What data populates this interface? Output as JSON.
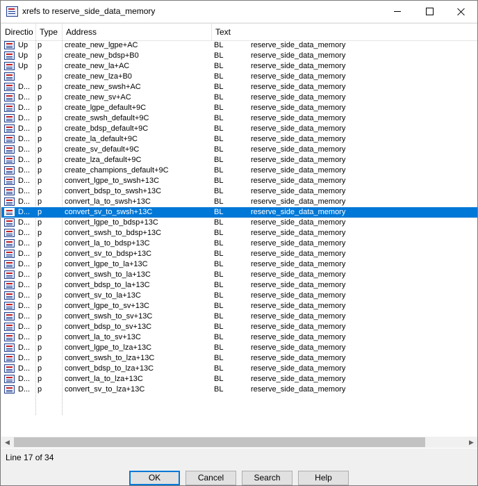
{
  "window": {
    "title": "xrefs to reserve_side_data_memory",
    "minimize_glyph": "minimize",
    "maximize_glyph": "maximize",
    "close_glyph": "close"
  },
  "columns": {
    "direction": "Directio",
    "type": "Type",
    "address": "Address",
    "text": "Text"
  },
  "rows": [
    {
      "dir": "Up",
      "type": "p",
      "address": "create_new_lgpe+AC",
      "text1": "BL",
      "text2": "reserve_side_data_memory"
    },
    {
      "dir": "Up",
      "type": "p",
      "address": "create_new_bdsp+B0",
      "text1": "BL",
      "text2": "reserve_side_data_memory"
    },
    {
      "dir": "Up",
      "type": "p",
      "address": "create_new_la+AC",
      "text1": "BL",
      "text2": "reserve_side_data_memory"
    },
    {
      "dir": "",
      "type": "p",
      "address": "create_new_lza+B0",
      "text1": "BL",
      "text2": "reserve_side_data_memory"
    },
    {
      "dir": "D...",
      "type": "p",
      "address": "create_new_swsh+AC",
      "text1": "BL",
      "text2": "reserve_side_data_memory"
    },
    {
      "dir": "D...",
      "type": "p",
      "address": "create_new_sv+AC",
      "text1": "BL",
      "text2": "reserve_side_data_memory"
    },
    {
      "dir": "D...",
      "type": "p",
      "address": "create_lgpe_default+9C",
      "text1": "BL",
      "text2": "reserve_side_data_memory"
    },
    {
      "dir": "D...",
      "type": "p",
      "address": "create_swsh_default+9C",
      "text1": "BL",
      "text2": "reserve_side_data_memory"
    },
    {
      "dir": "D...",
      "type": "p",
      "address": "create_bdsp_default+9C",
      "text1": "BL",
      "text2": "reserve_side_data_memory"
    },
    {
      "dir": "D...",
      "type": "p",
      "address": "create_la_default+9C",
      "text1": "BL",
      "text2": "reserve_side_data_memory"
    },
    {
      "dir": "D...",
      "type": "p",
      "address": "create_sv_default+9C",
      "text1": "BL",
      "text2": "reserve_side_data_memory"
    },
    {
      "dir": "D...",
      "type": "p",
      "address": "create_lza_default+9C",
      "text1": "BL",
      "text2": "reserve_side_data_memory"
    },
    {
      "dir": "D...",
      "type": "p",
      "address": "create_champions_default+9C",
      "text1": "BL",
      "text2": "reserve_side_data_memory"
    },
    {
      "dir": "D...",
      "type": "p",
      "address": "convert_lgpe_to_swsh+13C",
      "text1": "BL",
      "text2": "reserve_side_data_memory"
    },
    {
      "dir": "D...",
      "type": "p",
      "address": "convert_bdsp_to_swsh+13C",
      "text1": "BL",
      "text2": "reserve_side_data_memory"
    },
    {
      "dir": "D...",
      "type": "p",
      "address": "convert_la_to_swsh+13C",
      "text1": "BL",
      "text2": "reserve_side_data_memory"
    },
    {
      "dir": "D...",
      "type": "p",
      "address": "convert_sv_to_swsh+13C",
      "text1": "BL",
      "text2": "reserve_side_data_memory",
      "selected": true
    },
    {
      "dir": "D...",
      "type": "p",
      "address": "convert_lgpe_to_bdsp+13C",
      "text1": "BL",
      "text2": "reserve_side_data_memory"
    },
    {
      "dir": "D...",
      "type": "p",
      "address": "convert_swsh_to_bdsp+13C",
      "text1": "BL",
      "text2": "reserve_side_data_memory"
    },
    {
      "dir": "D...",
      "type": "p",
      "address": "convert_la_to_bdsp+13C",
      "text1": "BL",
      "text2": "reserve_side_data_memory"
    },
    {
      "dir": "D...",
      "type": "p",
      "address": "convert_sv_to_bdsp+13C",
      "text1": "BL",
      "text2": "reserve_side_data_memory"
    },
    {
      "dir": "D...",
      "type": "p",
      "address": "convert_lgpe_to_la+13C",
      "text1": "BL",
      "text2": "reserve_side_data_memory"
    },
    {
      "dir": "D...",
      "type": "p",
      "address": "convert_swsh_to_la+13C",
      "text1": "BL",
      "text2": "reserve_side_data_memory"
    },
    {
      "dir": "D...",
      "type": "p",
      "address": "convert_bdsp_to_la+13C",
      "text1": "BL",
      "text2": "reserve_side_data_memory"
    },
    {
      "dir": "D...",
      "type": "p",
      "address": "convert_sv_to_la+13C",
      "text1": "BL",
      "text2": "reserve_side_data_memory"
    },
    {
      "dir": "D...",
      "type": "p",
      "address": "convert_lgpe_to_sv+13C",
      "text1": "BL",
      "text2": "reserve_side_data_memory"
    },
    {
      "dir": "D...",
      "type": "p",
      "address": "convert_swsh_to_sv+13C",
      "text1": "BL",
      "text2": "reserve_side_data_memory"
    },
    {
      "dir": "D...",
      "type": "p",
      "address": "convert_bdsp_to_sv+13C",
      "text1": "BL",
      "text2": "reserve_side_data_memory"
    },
    {
      "dir": "D...",
      "type": "p",
      "address": "convert_la_to_sv+13C",
      "text1": "BL",
      "text2": "reserve_side_data_memory"
    },
    {
      "dir": "D...",
      "type": "p",
      "address": "convert_lgpe_to_lza+13C",
      "text1": "BL",
      "text2": "reserve_side_data_memory"
    },
    {
      "dir": "D...",
      "type": "p",
      "address": "convert_swsh_to_lza+13C",
      "text1": "BL",
      "text2": "reserve_side_data_memory"
    },
    {
      "dir": "D...",
      "type": "p",
      "address": "convert_bdsp_to_lza+13C",
      "text1": "BL",
      "text2": "reserve_side_data_memory"
    },
    {
      "dir": "D...",
      "type": "p",
      "address": "convert_la_to_lza+13C",
      "text1": "BL",
      "text2": "reserve_side_data_memory"
    },
    {
      "dir": "D...",
      "type": "p",
      "address": "convert_sv_to_lza+13C",
      "text1": "BL",
      "text2": "reserve_side_data_memory"
    }
  ],
  "status": {
    "text": "Line 17 of 34"
  },
  "buttons": {
    "ok": "OK",
    "cancel": "Cancel",
    "search": "Search",
    "help": "Help"
  },
  "colors": {
    "selection": "#0078d7",
    "icon_frame": "#1d3d8c",
    "icon_accent": "#c8201e"
  }
}
